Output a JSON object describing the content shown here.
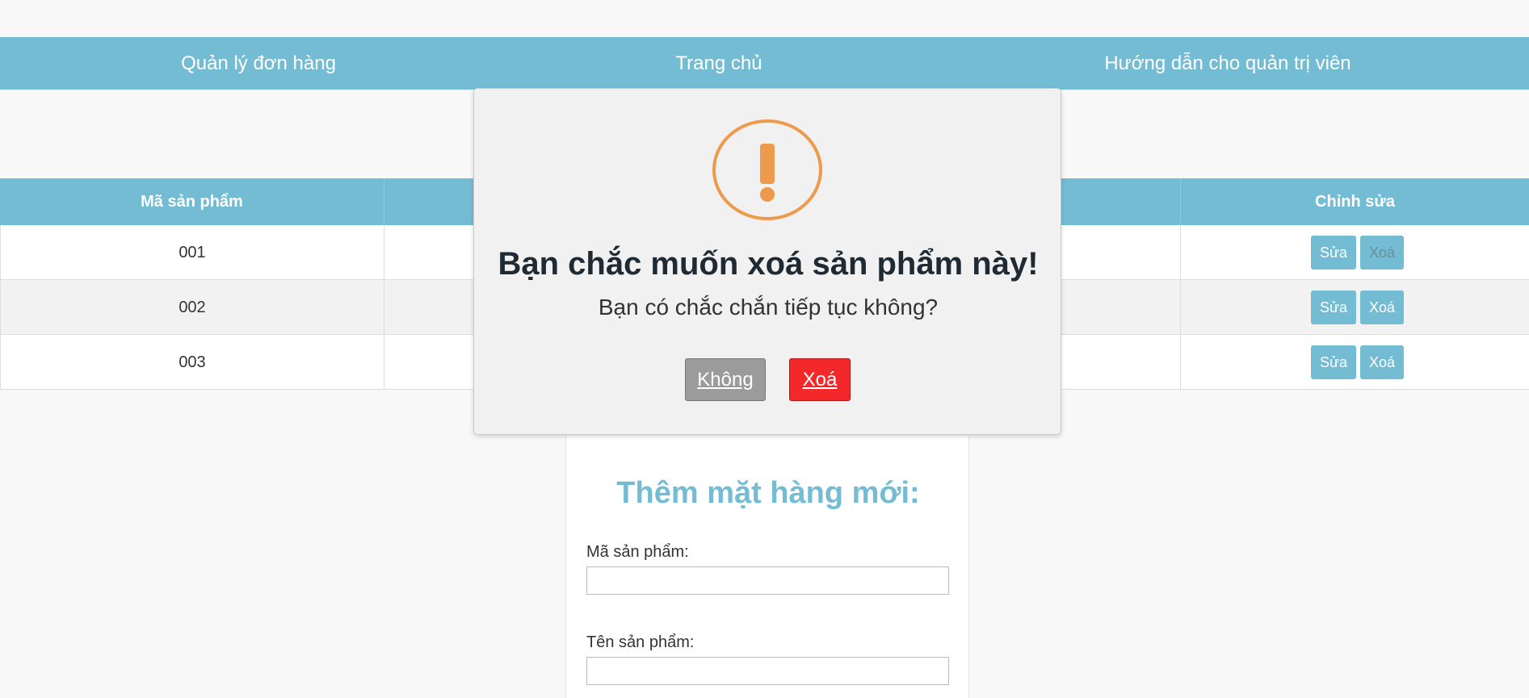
{
  "nav": {
    "items": [
      "Quản lý đơn hàng",
      "Trang chủ",
      "Hướng dẫn cho quản trị viên"
    ]
  },
  "table": {
    "headers": [
      "Mã sản phẩm",
      "Chỉnh sửa"
    ],
    "rows": [
      {
        "code": "001",
        "edit_label": "Sửa",
        "delete_label": "Xoá"
      },
      {
        "code": "002",
        "edit_label": "Sửa",
        "delete_label": "Xoá"
      },
      {
        "code": "003",
        "edit_label": "Sửa",
        "delete_label": "Xoá"
      }
    ]
  },
  "form": {
    "title": "Thêm mặt hàng mới:",
    "code_label": "Mã sản phẩm:",
    "code_value": "",
    "name_label": "Tên sản phẩm:",
    "name_value": ""
  },
  "modal": {
    "icon": "exclamation-circle-icon",
    "title": "Bạn chắc muốn xoá sản phẩm này!",
    "text": "Bạn có chắc chắn tiếp tục không?",
    "cancel_label": "Không",
    "confirm_label": "Xoá"
  },
  "colors": {
    "accent": "#74bcd4",
    "warning": "#f0a050",
    "danger": "#f3282a",
    "neutral_button": "#9b9b9b"
  }
}
